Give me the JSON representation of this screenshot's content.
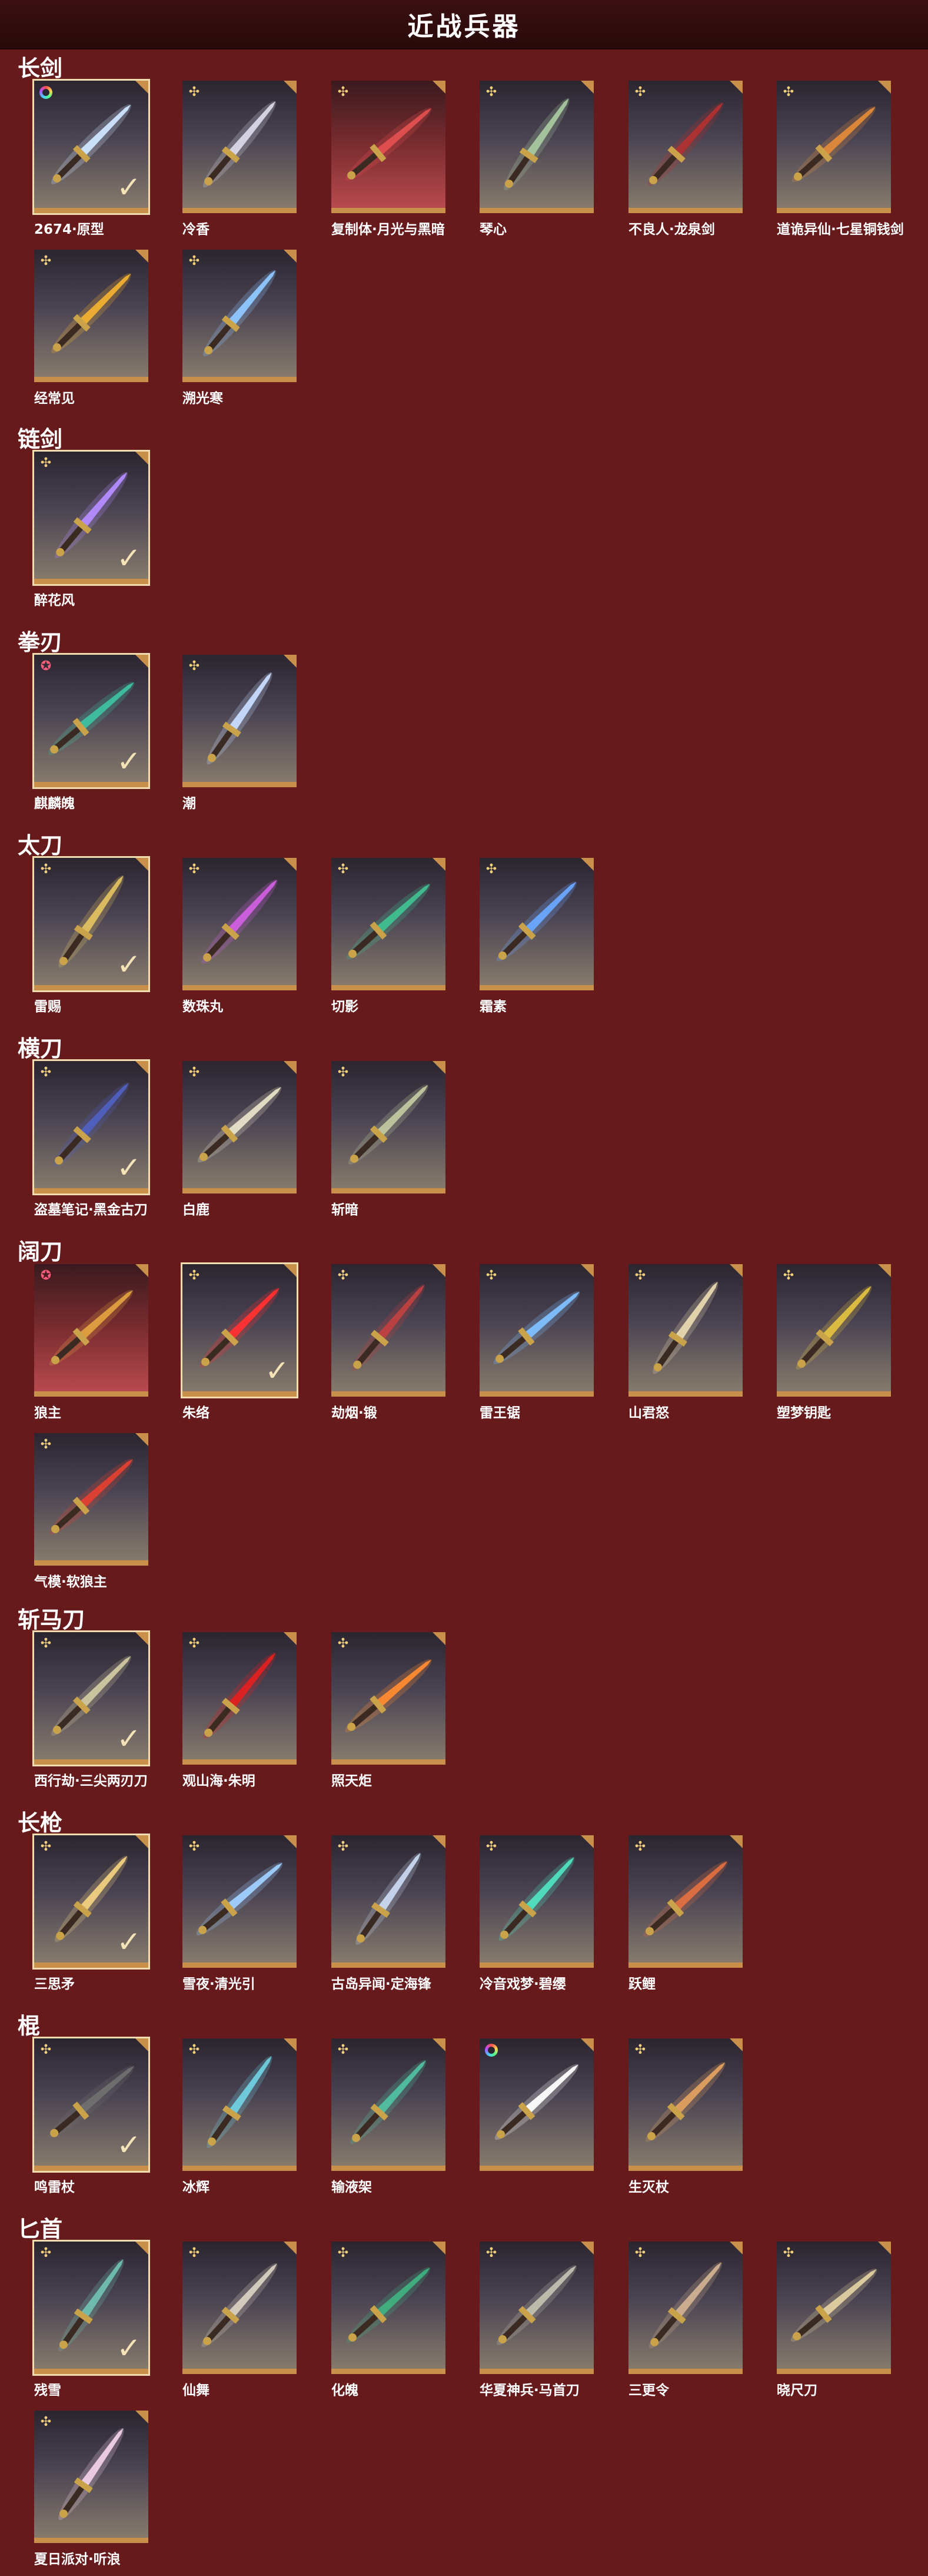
{
  "header": {
    "title": "近战兵器"
  },
  "colors": {
    "background": "#661a1c",
    "card_border": "#c8904a",
    "check": "#f5e3b8",
    "badge_gold": "#f3d07a",
    "badge_pink": "#ff5c7c"
  },
  "categories": [
    {
      "name": "长剑",
      "items": [
        {
          "name": "2674·原型",
          "badge": "rainbow-icon",
          "selected": true,
          "hue": "#cfe6ff"
        },
        {
          "name": "冷香",
          "badge": "sparkle-icon",
          "selected": false,
          "hue": "#d8d8e8"
        },
        {
          "name": "复制体·月光与黑暗",
          "badge": "sparkle-icon",
          "selected": false,
          "hue": "#e25050",
          "red": true
        },
        {
          "name": "琴心",
          "badge": "sparkle-icon",
          "selected": false,
          "hue": "#a8c8a0"
        },
        {
          "name": "不良人·龙泉剑",
          "badge": "sparkle-icon",
          "selected": false,
          "hue": "#b03030"
        },
        {
          "name": "道诡异仙·七星铜钱剑",
          "badge": "sparkle-icon",
          "selected": false,
          "hue": "#e08a3a"
        },
        {
          "name": "经常见",
          "badge": "sparkle-icon",
          "selected": false,
          "hue": "#f0b030"
        },
        {
          "name": "溯光寒",
          "badge": "sparkle-icon",
          "selected": false,
          "hue": "#8fc8ff"
        }
      ]
    },
    {
      "name": "链剑",
      "items": [
        {
          "name": "醉花风",
          "badge": "sparkle-icon",
          "selected": true,
          "hue": "#b58cff"
        }
      ]
    },
    {
      "name": "拳刃",
      "items": [
        {
          "name": "麒麟魄",
          "badge": "star-icon",
          "selected": true,
          "hue": "#3ec0a0"
        },
        {
          "name": "潮",
          "badge": "sparkle-icon",
          "selected": false,
          "hue": "#c8dcff"
        }
      ]
    },
    {
      "name": "太刀",
      "items": [
        {
          "name": "雷赐",
          "badge": "sparkle-icon",
          "selected": true,
          "hue": "#e0c060"
        },
        {
          "name": "数珠丸",
          "badge": "sparkle-icon",
          "selected": false,
          "hue": "#d060e0"
        },
        {
          "name": "切影",
          "badge": "sparkle-icon",
          "selected": false,
          "hue": "#40c090"
        },
        {
          "name": "霜素",
          "badge": "sparkle-icon",
          "selected": false,
          "hue": "#6aa8ff"
        }
      ]
    },
    {
      "name": "横刀",
      "items": [
        {
          "name": "盗墓笔记·黑金古刀",
          "badge": "sparkle-icon",
          "selected": true,
          "hue": "#5060c0"
        },
        {
          "name": "白鹿",
          "badge": "sparkle-icon",
          "selected": false,
          "hue": "#e8e0c8"
        },
        {
          "name": "斩暗",
          "badge": "sparkle-icon",
          "selected": false,
          "hue": "#c0c8a0"
        }
      ]
    },
    {
      "name": "阔刀",
      "items": [
        {
          "name": "狼主",
          "badge": "star-icon",
          "selected": false,
          "hue": "#e0a040",
          "red": true
        },
        {
          "name": "朱络",
          "badge": "sparkle-icon",
          "selected": true,
          "hue": "#ff3030"
        },
        {
          "name": "劫烟·锻",
          "badge": "sparkle-icon",
          "selected": false,
          "hue": "#c04040"
        },
        {
          "name": "雷王锯",
          "badge": "sparkle-icon",
          "selected": false,
          "hue": "#80c0ff"
        },
        {
          "name": "山君怒",
          "badge": "sparkle-icon",
          "selected": false,
          "hue": "#e8d8b0"
        },
        {
          "name": "塑梦钥匙",
          "badge": "sparkle-icon",
          "selected": false,
          "hue": "#e0c040"
        },
        {
          "name": "气模·软狼主",
          "badge": "sparkle-icon",
          "selected": false,
          "hue": "#e04030"
        }
      ]
    },
    {
      "name": "斩马刀",
      "items": [
        {
          "name": "西行劫·三尖两刃刀",
          "badge": "sparkle-icon",
          "selected": true,
          "hue": "#d0c8a0"
        },
        {
          "name": "观山海·朱明",
          "badge": "sparkle-icon",
          "selected": false,
          "hue": "#e02020"
        },
        {
          "name": "照天炬",
          "badge": "sparkle-icon",
          "selected": false,
          "hue": "#ff8a30"
        }
      ]
    },
    {
      "name": "长枪",
      "items": [
        {
          "name": "三思矛",
          "badge": "sparkle-icon",
          "selected": true,
          "hue": "#f0d080"
        },
        {
          "name": "雪夜·清光引",
          "badge": "sparkle-icon",
          "selected": false,
          "hue": "#a0d0ff"
        },
        {
          "name": "古岛异闻·定海锋",
          "badge": "sparkle-icon",
          "selected": false,
          "hue": "#c8d8f0"
        },
        {
          "name": "冷音戏梦·碧缨",
          "badge": "sparkle-icon",
          "selected": false,
          "hue": "#50e0c0"
        },
        {
          "name": "跃鲤",
          "badge": "sparkle-icon",
          "selected": false,
          "hue": "#e07040"
        }
      ]
    },
    {
      "name": "棍",
      "items": [
        {
          "name": "鸣雷杖",
          "badge": "sparkle-icon",
          "selected": true,
          "hue": "#707070"
        },
        {
          "name": "冰辉",
          "badge": "sparkle-icon",
          "selected": false,
          "hue": "#70d0e0"
        },
        {
          "name": "输液架",
          "badge": "sparkle-icon",
          "selected": false,
          "hue": "#50c0a0"
        },
        {
          "name": "",
          "badge": "rainbow-icon",
          "selected": false,
          "hue": "#ffffff"
        },
        {
          "name": "生灭杖",
          "badge": "sparkle-icon",
          "selected": false,
          "hue": "#e0a060"
        }
      ]
    },
    {
      "name": "匕首",
      "items": [
        {
          "name": "残雪",
          "badge": "sparkle-icon",
          "selected": true,
          "hue": "#70c0b0"
        },
        {
          "name": "仙舞",
          "badge": "sparkle-icon",
          "selected": false,
          "hue": "#d8d0c0"
        },
        {
          "name": "化魄",
          "badge": "sparkle-icon",
          "selected": false,
          "hue": "#40b080"
        },
        {
          "name": "华夏神兵·马首刀",
          "badge": "sparkle-icon",
          "selected": false,
          "hue": "#c0c0b0"
        },
        {
          "name": "三更令",
          "badge": "sparkle-icon",
          "selected": false,
          "hue": "#d0b090"
        },
        {
          "name": "晓尺刀",
          "badge": "sparkle-icon",
          "selected": false,
          "hue": "#e0d0a0"
        },
        {
          "name": "夏日派对·听浪",
          "badge": "sparkle-icon",
          "selected": false,
          "hue": "#f0d0e8"
        }
      ]
    }
  ]
}
